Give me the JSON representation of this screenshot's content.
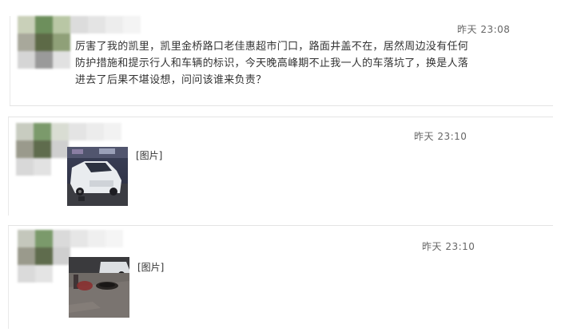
{
  "posts": [
    {
      "timestamp": "昨天 23:08",
      "text": "厉害了我的凯里，凯里金桥路口老佳惠超市门口，路面井盖不在，居然周边没有任何防护措施和提示行人和车辆的标识，今天晚高峰期不止我一人的车落坑了，换是人落进去了后果不堪设想，问问该谁来负责？"
    },
    {
      "timestamp": "昨天 23:10",
      "image_label": "[图片]"
    },
    {
      "timestamp": "昨天 23:10",
      "image_label": "[图片]"
    }
  ]
}
